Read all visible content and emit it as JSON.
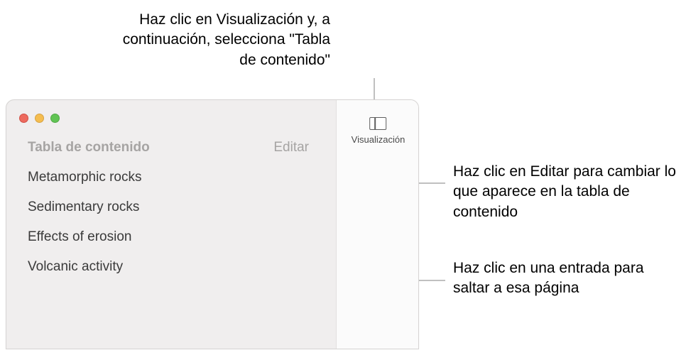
{
  "callouts": {
    "top": "Haz clic en Visualización y, a continuación, selecciona \"Tabla de contenido\"",
    "right1": "Haz clic en Editar para cambiar lo que aparece en la tabla de contenido",
    "right2": "Haz clic en una entrada para saltar a esa página"
  },
  "toolbar": {
    "view_label": "Visualización"
  },
  "toc": {
    "title": "Tabla de contenido",
    "edit_label": "Editar",
    "items": [
      "Metamorphic rocks",
      "Sedimentary rocks",
      "Effects of erosion",
      "Volcanic activity"
    ]
  }
}
